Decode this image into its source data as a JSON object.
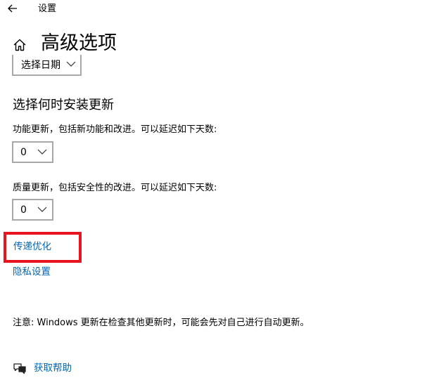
{
  "window": {
    "title": "设置",
    "back_icon": "back-arrow-icon"
  },
  "header": {
    "home_icon": "home-icon",
    "title": "高级选项"
  },
  "date_dropdown": {
    "value": "选择日期",
    "chevron_icon": "chevron-down-icon"
  },
  "install_section": {
    "heading": "选择何时安装更新",
    "feature_updates": {
      "label": "功能更新，包括新功能和改进。可以延迟如下天数:",
      "value": "0"
    },
    "quality_updates": {
      "label": "质量更新，包括安全性的改进。可以延迟如下天数:",
      "value": "0"
    }
  },
  "links": {
    "delivery_optimization": "传递优化",
    "privacy_settings": "隐私设置"
  },
  "note": "注意: Windows 更新在检查其他更新时，可能会先对自己进行自动更新。",
  "help": {
    "icon": "help-chat-icon",
    "label": "获取帮助"
  },
  "colors": {
    "link": "#0066b4",
    "highlight": "#e8141e",
    "dropdown_border": "#a8a8a8"
  }
}
